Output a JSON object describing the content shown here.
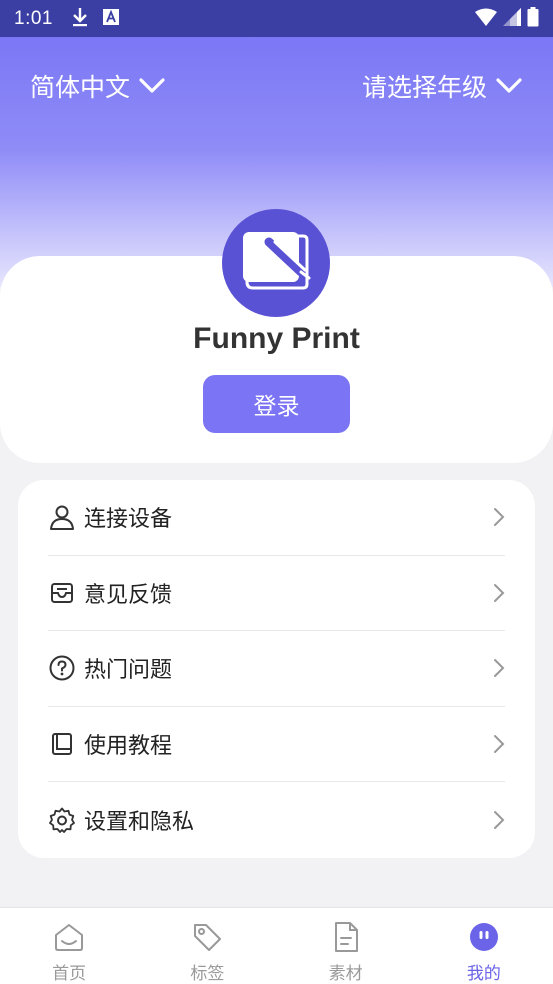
{
  "status_bar": {
    "time": "1:01",
    "icons_left": [
      "download-icon",
      "a-notification-icon"
    ],
    "icons_right": [
      "wifi-icon",
      "signal-icon",
      "battery-icon"
    ]
  },
  "header": {
    "language": "简体中文",
    "grade": "请选择年级"
  },
  "profile": {
    "app_name": "Funny Print",
    "login_label": "登录"
  },
  "menu": {
    "items": [
      {
        "label": "连接设备",
        "icon": "user-icon"
      },
      {
        "label": "意见反馈",
        "icon": "inbox-icon"
      },
      {
        "label": "热门问题",
        "icon": "question-icon"
      },
      {
        "label": "使用教程",
        "icon": "book-icon"
      },
      {
        "label": "设置和隐私",
        "icon": "gear-icon"
      }
    ]
  },
  "bottom_nav": {
    "items": [
      {
        "label": "首页",
        "icon": "home-icon"
      },
      {
        "label": "标签",
        "icon": "tag-icon"
      },
      {
        "label": "素材",
        "icon": "document-icon"
      },
      {
        "label": "我的",
        "icon": "profile-icon",
        "active": true
      }
    ]
  },
  "colors": {
    "accent": "#7b75f5",
    "status_bar": "#3b3fa3",
    "avatar": "#5a52d5",
    "active_nav": "#6b63e8"
  }
}
